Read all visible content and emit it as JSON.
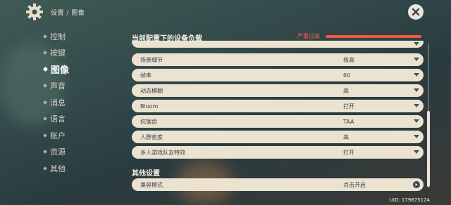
{
  "header": {
    "breadcrumb": "设置 / 图像"
  },
  "sidebar": {
    "items": [
      {
        "label": "控制",
        "active": false
      },
      {
        "label": "按键",
        "active": false
      },
      {
        "label": "图像",
        "active": true
      },
      {
        "label": "声音",
        "active": false
      },
      {
        "label": "消息",
        "active": false
      },
      {
        "label": "语言",
        "active": false
      },
      {
        "label": "账户",
        "active": false
      },
      {
        "label": "资源",
        "active": false
      },
      {
        "label": "其他",
        "active": false
      }
    ]
  },
  "main": {
    "load_title": "当前配置下的设备负载",
    "load_status": "严重过高",
    "load_level": 1.0,
    "load_color": "#ee5a3c",
    "settings": [
      {
        "label": "场景细节",
        "value": "极高"
      },
      {
        "label": "帧率",
        "value": "60"
      },
      {
        "label": "动态模糊",
        "value": "高"
      },
      {
        "label": "Bloom",
        "value": "打开"
      },
      {
        "label": "抗锯齿",
        "value": "TAA"
      },
      {
        "label": "人群密度",
        "value": "高"
      },
      {
        "label": "多人游戏队友特效",
        "value": "打开"
      }
    ],
    "other_title": "其他设置",
    "compat_label": "兼容模式",
    "compat_value": "点击开启"
  },
  "footer": {
    "uid": "UID: 179875124"
  }
}
